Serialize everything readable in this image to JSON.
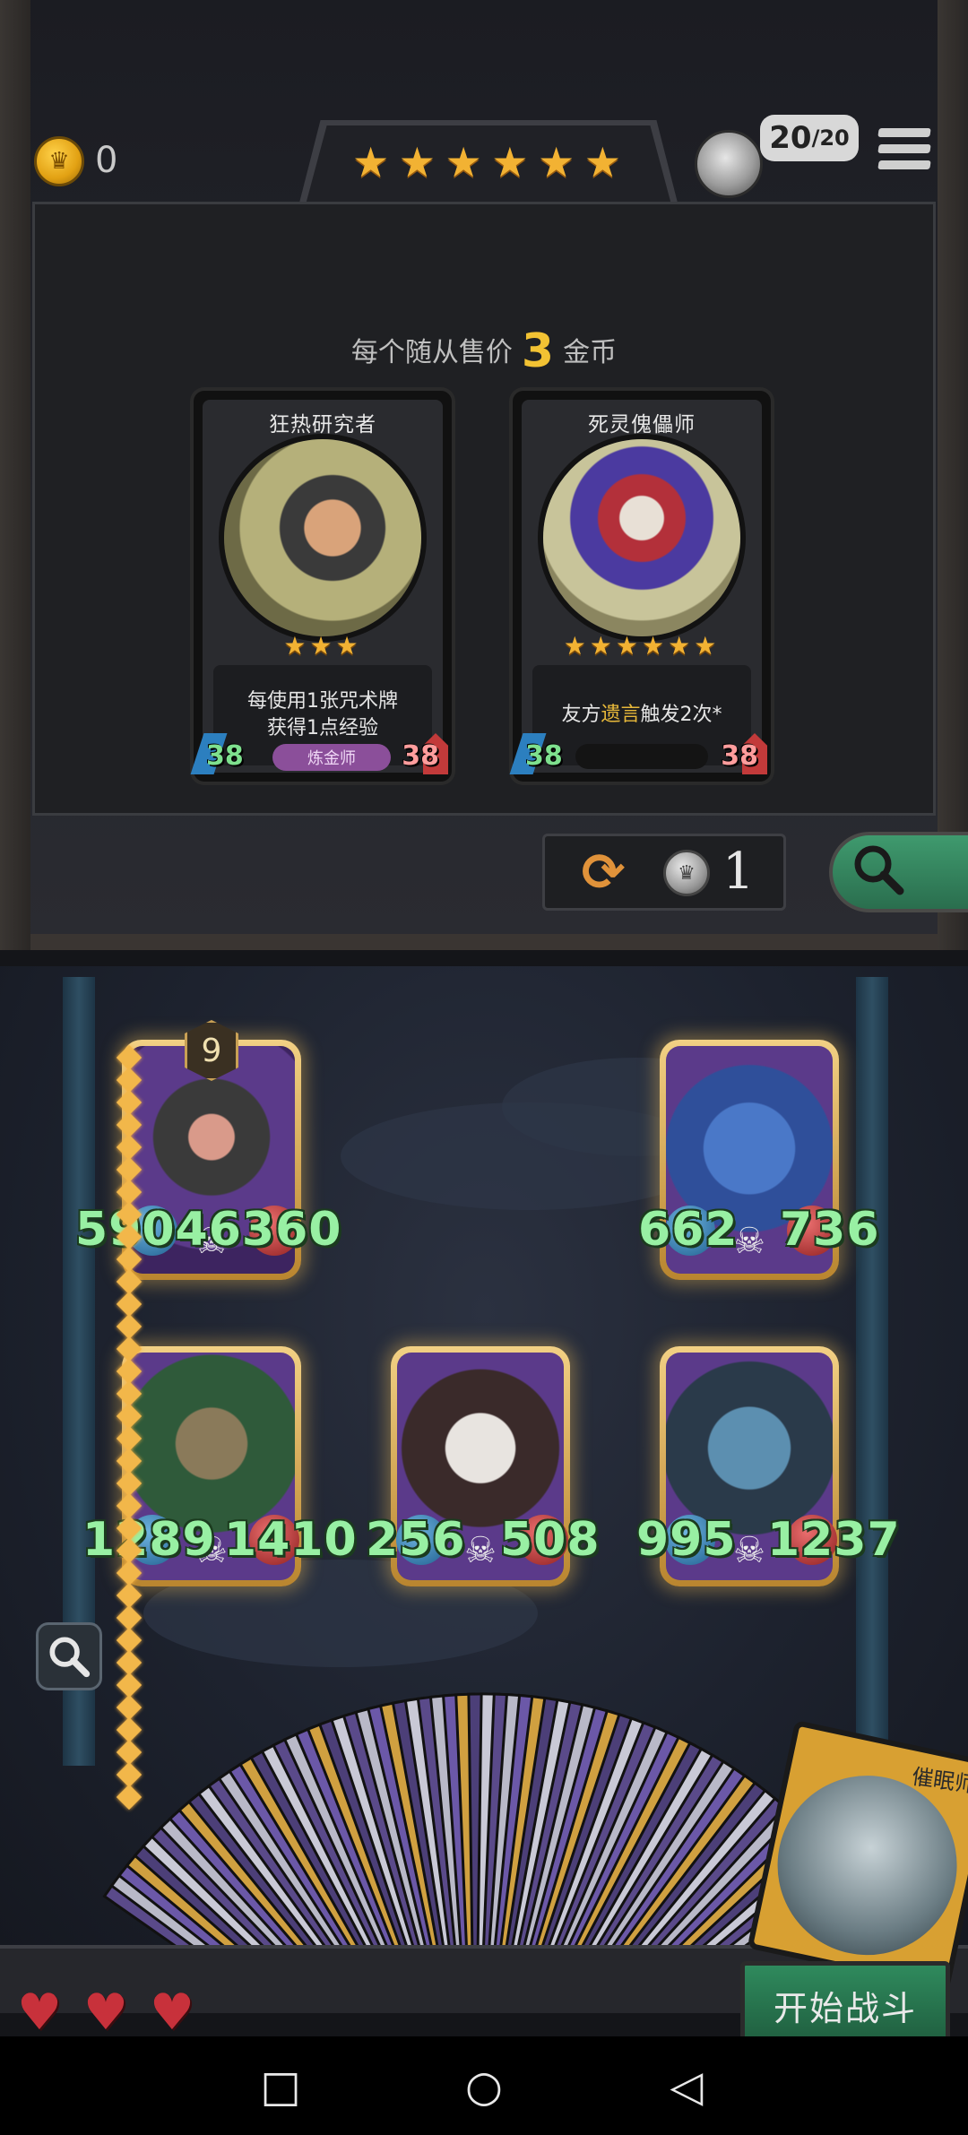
{
  "header": {
    "gold": "0",
    "tavern_stars": 6,
    "star_glyph": "★",
    "turn_current": "20",
    "turn_max": "/20"
  },
  "shop": {
    "price_prefix": "每个随从售价",
    "price_value": "3",
    "price_suffix": "金币",
    "cards": [
      {
        "name": "狂热研究者",
        "stars": "★★★",
        "desc_parts": [
          "每使用1张咒术牌",
          "获得1点经验"
        ],
        "attack": "38",
        "health": "38",
        "tag": "炼金师"
      },
      {
        "name": "死灵傀儡师",
        "stars": "★★★★★★",
        "desc_pre": "友方",
        "desc_hl": "遗言",
        "desc_post": "触发2次*",
        "attack": "38",
        "health": "38"
      }
    ],
    "refresh_cost": "1"
  },
  "board": {
    "level": "9",
    "minions": [
      {
        "attack": "59",
        "health": "046360",
        "combined": "59046360"
      },
      {
        "attack": "662",
        "health": "736"
      },
      {
        "attack": "1289",
        "health": "1410"
      },
      {
        "attack": "256",
        "health": "508"
      },
      {
        "attack": "995",
        "health": "1237"
      }
    ]
  },
  "hero": {
    "name": "催眠师"
  },
  "lives": 3,
  "start_button": "开始战斗",
  "colors": {
    "gold_star": "#f2b233",
    "stat_green": "#98f0a3",
    "start_green": "#2f8a5d",
    "heart_red": "#c8313b",
    "keyword_gold": "#e8b93a"
  },
  "icons": {
    "gold": "crown-coin-icon",
    "menu": "hamburger-icon",
    "refresh": "refresh-icon",
    "freeze_cost": "silver-coin-icon",
    "search": "magnifier-icon",
    "life": "heart-icon",
    "skull": "skull-icon"
  },
  "nav": {
    "recent": "□",
    "home": "○",
    "back": "◁"
  }
}
